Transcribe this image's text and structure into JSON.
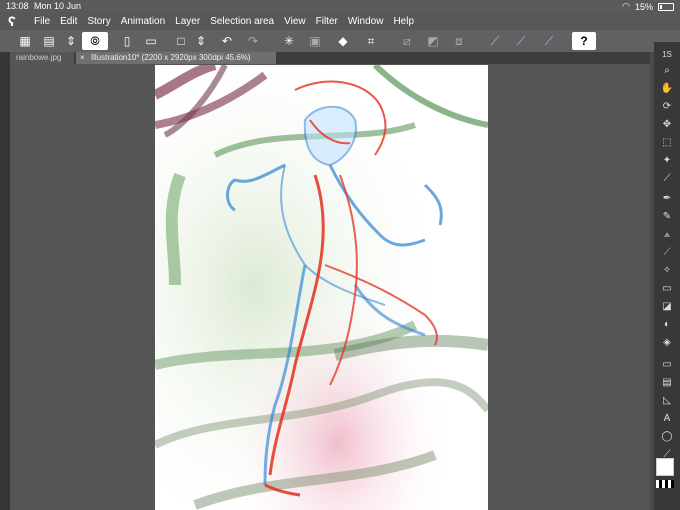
{
  "status": {
    "time": "13:08",
    "date": "Mon 10 Jun",
    "battery": "15%"
  },
  "menu": [
    "File",
    "Edit",
    "Story",
    "Animation",
    "Layer",
    "Selection area",
    "View",
    "Filter",
    "Window",
    "Help"
  ],
  "tabs": [
    {
      "label": "rainbowe.jpg"
    },
    {
      "label": "Illustration10* (2200 x 2920px 300dpi 45.6%)"
    }
  ],
  "toolbar": {
    "help_label": "?"
  },
  "icons": {
    "logo": "clip-studio-logo",
    "wifi": "wifi-icon",
    "battery": "battery-icon"
  }
}
